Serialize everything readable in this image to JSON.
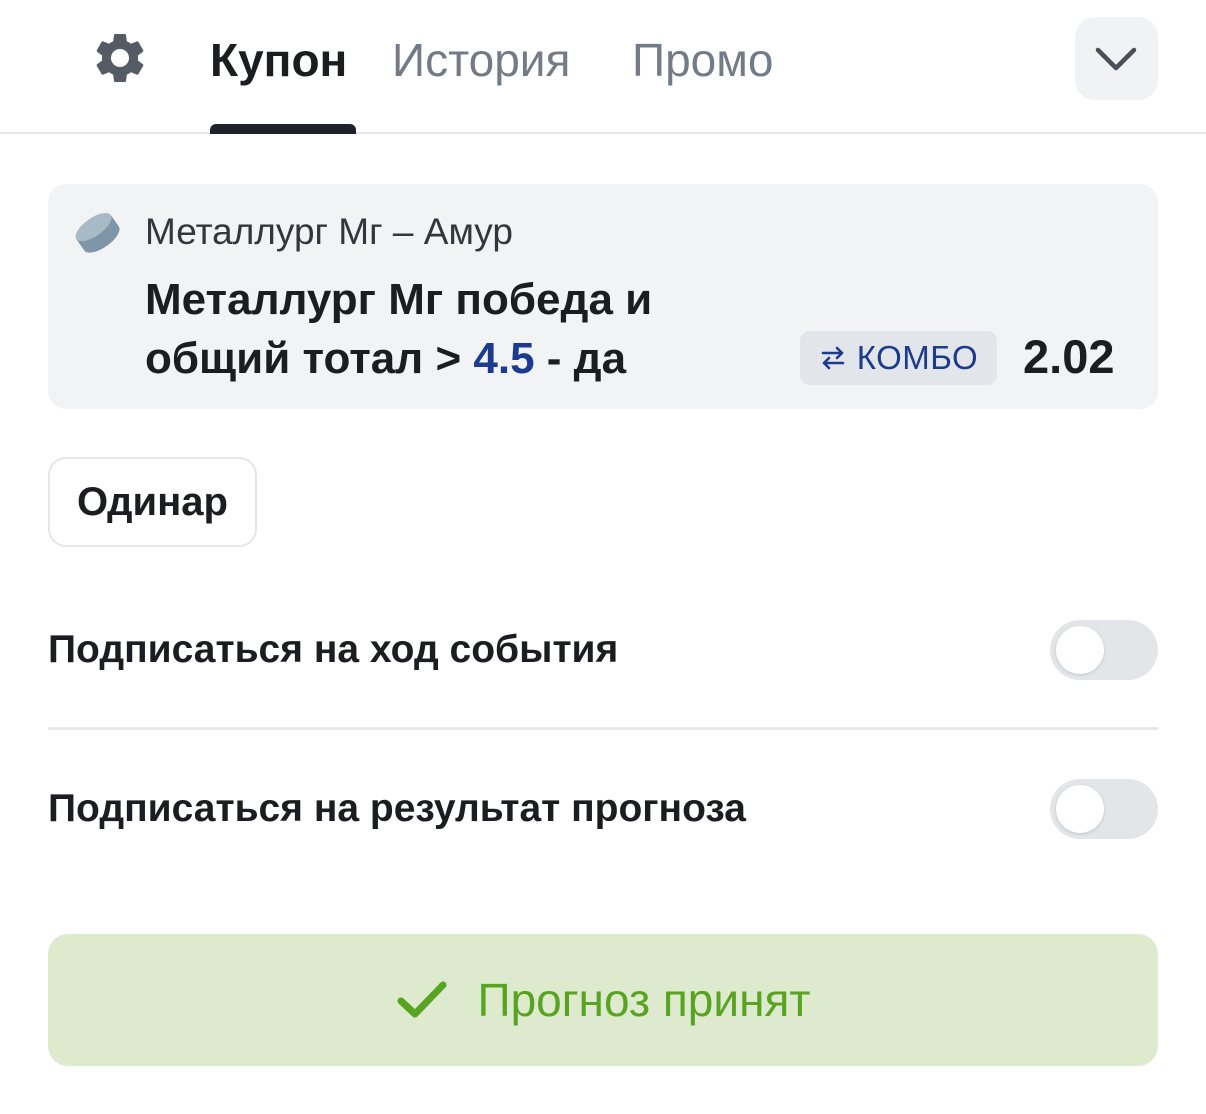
{
  "tabs": {
    "coupon": "Купон",
    "history": "История",
    "promo": "Промо",
    "active": "coupon"
  },
  "icons": {
    "settings": "gear-icon",
    "collapse": "chevron-down-icon",
    "sport": "hockey-puck-icon",
    "combo": "swap-arrows-icon",
    "accepted": "check-icon"
  },
  "bet": {
    "event": "Металлург Мг – Амур",
    "market_line1": "Металлург Мг победа и",
    "market_line2_prefix": "общий тотал > ",
    "market_total": "4.5",
    "market_line2_suffix": " - да",
    "combo_label": "КОМБО",
    "odds": "2.02"
  },
  "bet_type": {
    "label": "Одинар"
  },
  "subscriptions": [
    {
      "label": "Подписаться на ход события",
      "enabled": false
    },
    {
      "label": "Подписаться на результат прогноза",
      "enabled": false
    }
  ],
  "status": {
    "label": "Прогноз принят"
  },
  "colors": {
    "accent_blue": "#1c3b8f",
    "success_green": "#58a321",
    "success_bg": "#deeacd",
    "card_bg": "#f2f3f5",
    "muted_text": "#747b86"
  }
}
